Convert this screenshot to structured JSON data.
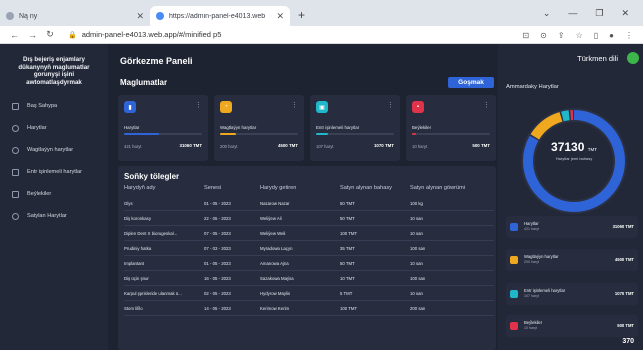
{
  "browser": {
    "tab_inactive_title": "Ną ny",
    "tab_active_title": "https://admin-panel-e4013.web",
    "new_tab": "+",
    "url": "admin-panel-e4013.web.app/#/minified p5"
  },
  "sidebar": {
    "brand": "Dış bejeriş enjamlary dükanynyň maglumatlar gorunyşi işini awtomatlaşdyrmak",
    "items": [
      {
        "label": "Baş Sahypa"
      },
      {
        "label": "Harytlar"
      },
      {
        "label": "Wagtlaýyn harytlar"
      },
      {
        "label": "Entr işinlemeli harytlar"
      },
      {
        "label": "Beýlekiler"
      },
      {
        "label": "Satylan Harytlar"
      }
    ]
  },
  "main": {
    "page_title": "Görkezme Paneli",
    "section_title": "Maglumatlar",
    "add_button": "Goşmak",
    "cards": [
      {
        "label": "Harytlar",
        "count": "421 haryt",
        "amount": "31060 TMT",
        "icon": "document-icon",
        "color": "#2f64d8",
        "progress": 0.45
      },
      {
        "label": "Wagtlaýyn harytlar",
        "count": "200 haryt",
        "amount": "4500 TMT",
        "icon": "clock-icon",
        "color": "#f0a81e",
        "progress": 0.2
      },
      {
        "label": "Entr işinlemeli harytlar",
        "count": "107 haryt",
        "amount": "1070 TMT",
        "icon": "cart-icon",
        "color": "#1fb7c9",
        "progress": 0.15
      },
      {
        "label": "Beýlekiler",
        "count": "10 haryt",
        "amount": "500 TMT",
        "icon": "box-icon",
        "color": "#e0334a",
        "progress": 0.05
      }
    ],
    "table": {
      "title": "Soňky tölegler",
      "headers": [
        "Harydyň ady",
        "Senesi",
        "Harydy getiren",
        "Satyn alynan bahasy",
        "Satyn alynan göwrümi"
      ],
      "rows": [
        [
          "Glys",
          "01 - 05 - 2023",
          "Nazarow Nazar",
          "50 TMT",
          "100 kg"
        ],
        [
          "Diş koronkasy",
          "22 - 05 - 2023",
          "Weliýew Ali",
          "50 TMT",
          "10 san"
        ],
        [
          "Diplen Dent X biorugeskal...",
          "07 - 05 - 2023",
          "Weliýew Weli",
          "100 TMT",
          "10 san"
        ],
        [
          "Prudiniy hatka",
          "07 - 03 - 2023",
          "Myradowa Laçyn",
          "35 TMT",
          "100 san"
        ],
        [
          "Implantant",
          "01 - 05 - 2023",
          "Amanowa Ajna",
          "50 TMT",
          "10 san"
        ],
        [
          "Diş üçin şnur",
          "16 - 05 - 2023",
          "Sazakowa Maýsa",
          "10 TMT",
          "100 san"
        ],
        [
          "Karpul şprisleride ulanmak ü...",
          "02 - 05 - 2023",
          "Hydyrow Maylis",
          "5 TMT",
          "10 san"
        ],
        [
          "Stom lifilo",
          "14 - 05 - 2023",
          "Kerimow Kerim",
          "100 TMT",
          "200 san"
        ]
      ]
    }
  },
  "right_panel": {
    "language": "Türkmen dili",
    "title": "Ammardaky Harytlar",
    "total": "37130",
    "total_unit": "TMT",
    "total_sub": "Harytlar jemi bahasy",
    "legend": [
      {
        "name": "Harytlar",
        "count": "421 haryt",
        "amount": "31060 TMT",
        "color": "#2f64d8",
        "value": 31060
      },
      {
        "name": "Wagtlaýyn harytlar",
        "count": "200 haryt",
        "amount": "4500 TMT",
        "color": "#f0a81e",
        "value": 4500
      },
      {
        "name": "Entr işinlemeli harytlar",
        "count": "107 haryt",
        "amount": "1070 TMT",
        "color": "#1fb7c9",
        "value": 1070
      },
      {
        "name": "Beýlekiler",
        "count": "10 haryt",
        "amount": "500 TMT",
        "color": "#e0334a",
        "value": 500
      }
    ],
    "bottom_value": "370"
  }
}
